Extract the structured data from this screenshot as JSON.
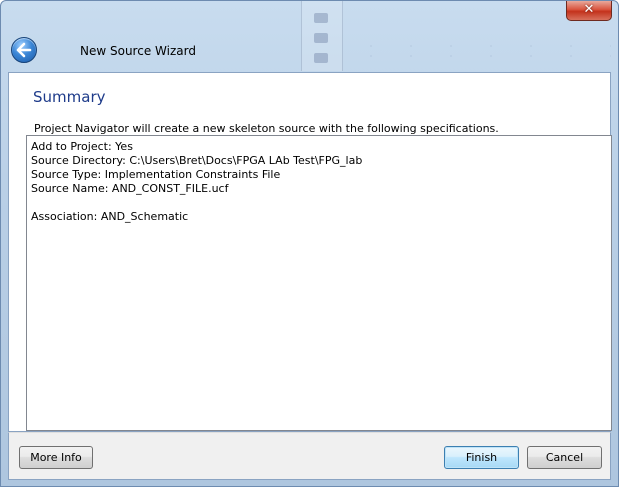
{
  "window": {
    "title": "New Source Wizard",
    "close_glyph": "✕"
  },
  "icons": {
    "back": "back-arrow-icon",
    "close": "close-icon"
  },
  "page": {
    "heading": "Summary",
    "intro": "Project Navigator will create a new skeleton source with the following specifications."
  },
  "details": {
    "lines": [
      "Add to Project: Yes",
      "Source Directory: C:\\Users\\Bret\\Docs\\FPGA LAb Test\\FPG_lab",
      "Source Type: Implementation Constraints File",
      "Source Name: AND_CONST_FILE.ucf",
      "",
      "Association: AND_Schematic"
    ]
  },
  "buttons": {
    "more_info": "More Info",
    "finish": "Finish",
    "cancel": "Cancel"
  },
  "colors": {
    "heading": "#1e3b8a",
    "frame": "#b9cfe6",
    "close": "#c3321c",
    "default_button_border": "#3c7fb1"
  }
}
